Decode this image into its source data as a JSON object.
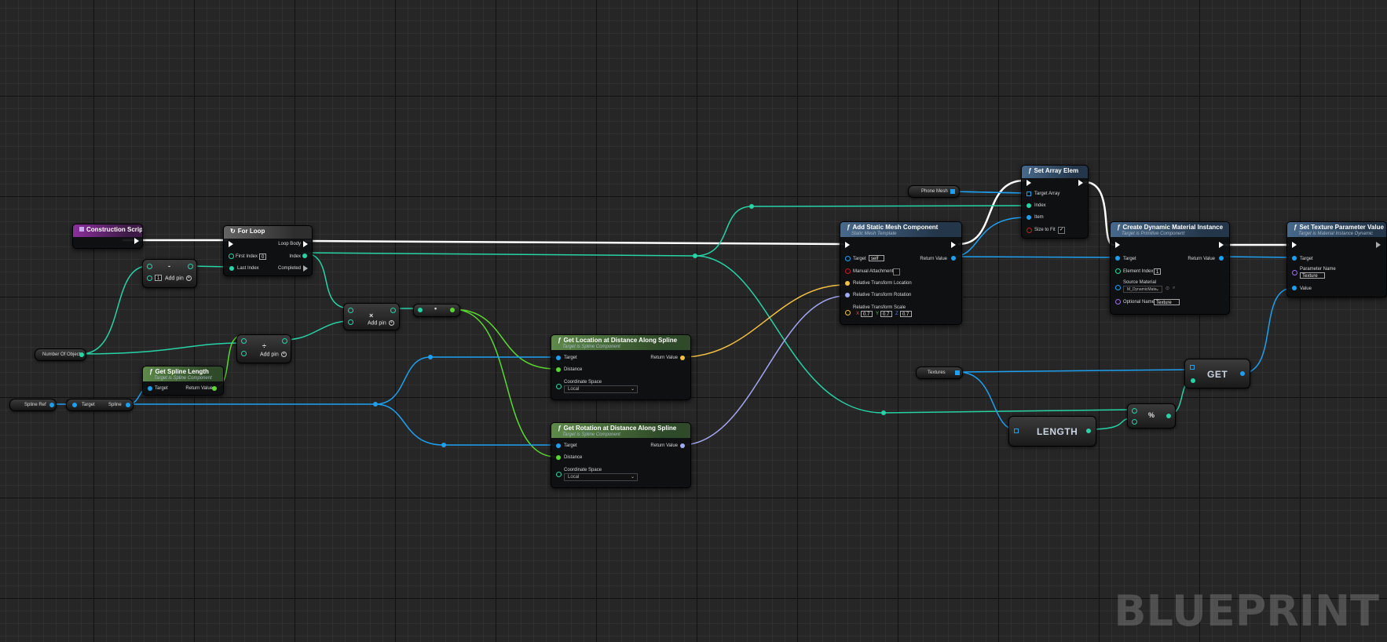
{
  "watermark": "BLUEPRINT",
  "nodes": {
    "construction_script": {
      "title": "Construction Script"
    },
    "for_loop": {
      "title": "For Loop",
      "loop_body": "Loop Body",
      "first_index": "First Index",
      "first_index_value": "0",
      "index": "Index",
      "last_index": "Last Index",
      "completed": "Completed"
    },
    "subtract": {
      "symbol": "-",
      "value": "1",
      "add_pin": "Add pin"
    },
    "multiply": {
      "symbol": "×",
      "add_pin": "Add pin"
    },
    "divide": {
      "symbol": "÷",
      "add_pin": "Add pin"
    },
    "convert": {
      "symbol": "•"
    },
    "number_of_object": {
      "label": "Number Of Object"
    },
    "spline_ref": {
      "label": "Spline Ref"
    },
    "get_spline": {
      "target": "Target",
      "spline": "Spline"
    },
    "get_spline_length": {
      "title": "Get Spline Length",
      "subtitle": "Target is Spline Component",
      "target": "Target",
      "return_value": "Return Value"
    },
    "get_location": {
      "title": "Get Location at Distance Along Spline",
      "subtitle": "Target is Spline Component",
      "target": "Target",
      "return_value": "Return Value",
      "distance": "Distance",
      "coordinate_space": "Coordinate Space",
      "coordinate_value": "Local"
    },
    "get_rotation": {
      "title": "Get Rotation at Distance Along Spline",
      "subtitle": "Target is Spline Component",
      "target": "Target",
      "return_value": "Return Value",
      "distance": "Distance",
      "coordinate_space": "Coordinate Space",
      "coordinate_value": "Local"
    },
    "add_static_mesh": {
      "title": "Add Static Mesh Component",
      "subtitle": "Static Mesh Template",
      "target": "Target",
      "target_value": "self",
      "return_value": "Return Value",
      "manual_attachment": "Manual Attachment",
      "rel_location": "Relative Transform Location",
      "rel_rotation": "Relative Transform Rotation",
      "rel_scale": "Relative Transform Scale",
      "scale_x_label": "X",
      "scale_x": "0.7",
      "scale_y_label": "Y",
      "scale_y": "0.7",
      "scale_z_label": "Z",
      "scale_z": "0.7"
    },
    "phone_mesh": {
      "label": "Phone Mesh"
    },
    "set_array_elem": {
      "title": "Set Array Elem",
      "target_array": "Target Array",
      "index": "Index",
      "item": "Item",
      "size_to_fit": "Size to Fit"
    },
    "create_dmi": {
      "title": "Create Dynamic Material Instance",
      "subtitle": "Target is Primitive Component",
      "target": "Target",
      "return_value": "Return Value",
      "element_index": "Element Index",
      "element_index_value": "1",
      "source_material": "Source Material",
      "source_material_value": "M_DynamicMate",
      "optional_name": "Optional Name",
      "optional_name_value": "Texture"
    },
    "set_texture_param": {
      "title": "Set Texture Parameter Value",
      "subtitle": "Target is Material Instance Dynamic",
      "target": "Target",
      "parameter_name": "Parameter Name",
      "parameter_name_value": "Texture",
      "value": "Value"
    },
    "textures": {
      "label": "Textures"
    },
    "get_node": {
      "label": "GET"
    },
    "length_node": {
      "label": "LENGTH"
    },
    "modulo": {
      "symbol": "%"
    }
  },
  "colors": {
    "exec": "#ffffff",
    "object": "#1ea0f0",
    "int": "#26d4a6",
    "float": "#5ad830",
    "vector": "#f5c042",
    "rotator": "#a3a8f3"
  }
}
